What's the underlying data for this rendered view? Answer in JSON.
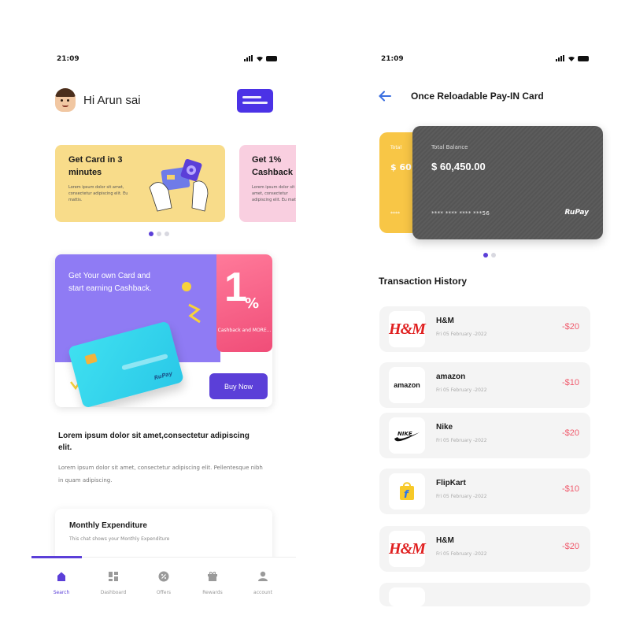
{
  "left": {
    "status": {
      "time": "21:09"
    },
    "greeting": "Hi Arun sai",
    "promos": [
      {
        "title": "Get Card in 3 minutes",
        "body": "Lorem ipsum dolor sit amet, consectetur adipiscing elit. Eu mattis."
      },
      {
        "title": "Get 1% Cashback",
        "body": "Lorem ipsum dolor sit amet, consectetur adipiscing elit. Eu mattis."
      }
    ],
    "banner": {
      "heading": "Get Your own Card and start earning Cashback.",
      "percent_digit": "1",
      "percent_sign": "%",
      "caption": "Cashback and MORE...",
      "card_brand": "RuPay",
      "buy_label": "Buy Now"
    },
    "lorem": {
      "heading": "Lorem ipsum dolor sit amet,consectetur adipiscing elit.",
      "body": "Lorem ipsum dolor sit amet, consectetur adipiscing elit. Pellentesque nibh in quam adipiscing."
    },
    "expenditure": {
      "title": "Monthly Expenditure",
      "subtitle": "This chat shows your Monthly Expenditure"
    },
    "tabs": [
      {
        "label": "Search",
        "icon": "home-icon",
        "active": true
      },
      {
        "label": "Dashboard",
        "icon": "dashboard-icon",
        "active": false
      },
      {
        "label": "Offers",
        "icon": "offers-icon",
        "active": false
      },
      {
        "label": "Rewards",
        "icon": "rewards-icon",
        "active": false
      },
      {
        "label": "account",
        "icon": "account-icon",
        "active": false
      }
    ]
  },
  "right": {
    "status": {
      "time": "21:09"
    },
    "title": "Once Reloadable Pay-IN Card",
    "back_card": {
      "label": "Total",
      "balance": "$ 60",
      "number": "****"
    },
    "front_card": {
      "label": "Total Balance",
      "balance": "$ 60,450.00",
      "number": "**** **** **** ***56",
      "brand": "RuPay"
    },
    "history_title": "Transaction History",
    "transactions": [
      {
        "merchant": "H&M",
        "logo": "H&M",
        "date": "Fri 05 February -2022",
        "amount": "-$20"
      },
      {
        "merchant": "amazon",
        "logo": "amazon",
        "date": "Fri 05 February -2022",
        "amount": "-$10"
      },
      {
        "merchant": "Nike",
        "logo": "NIKE",
        "date": "Fri 05 February -2022",
        "amount": "-$20"
      },
      {
        "merchant": "FlipKart",
        "logo": "f",
        "date": "Fri 05 February -2022",
        "amount": "-$10"
      },
      {
        "merchant": "H&M",
        "logo": "H&M",
        "date": "Fri 05 February -2022",
        "amount": "-$20"
      }
    ]
  },
  "colors": {
    "accent": "#5b3fd8",
    "pink": "#f04d78",
    "amount": "#f05a6c",
    "yellow": "#f8dc8a"
  }
}
